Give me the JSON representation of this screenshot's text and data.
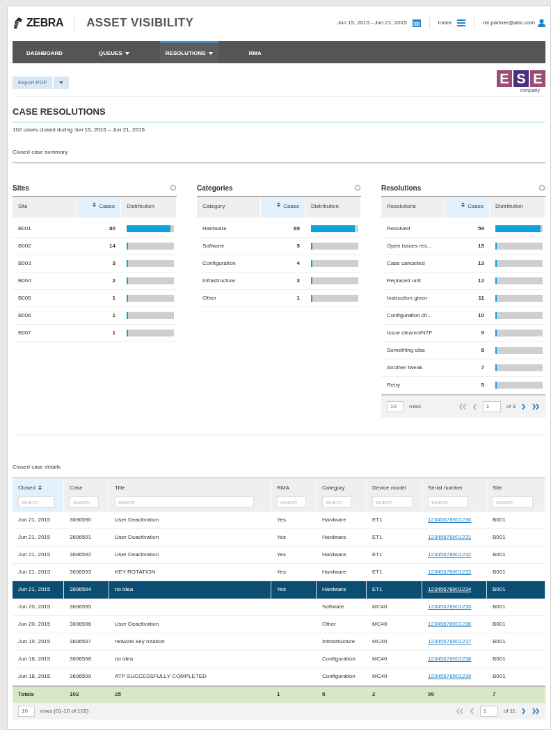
{
  "header": {
    "brand": "ZEBRA",
    "app_title": "ASSET VISIBILITY",
    "date_range": "Jun 15, 2015 - Jun 21, 2015",
    "index_label": "Index",
    "user": "mr.partner@abc.com"
  },
  "nav": [
    {
      "label": "DASHBOARD",
      "dropdown": false,
      "selected": false
    },
    {
      "label": "QUEUES",
      "dropdown": true,
      "selected": false
    },
    {
      "label": "RESOLUTIONS",
      "dropdown": true,
      "selected": true
    },
    {
      "label": "RMA",
      "dropdown": false,
      "selected": false
    }
  ],
  "export_button": "Export PDF",
  "company_logo": {
    "letters": [
      "E",
      "S",
      "E"
    ],
    "caption": "company"
  },
  "page_title": "CASE RESOLUTIONS",
  "summary_text": "102 cases closed during Jun 15, 2015 – Jun 21, 2015.",
  "summary_heading": "Closed case summary",
  "panels": [
    {
      "title": "Sites",
      "columns": [
        {
          "label": "Site",
          "sorted": false
        },
        {
          "label": "Cases",
          "sorted": true
        },
        {
          "label": "Distribution",
          "sorted": false
        }
      ],
      "rows": [
        {
          "name": "B001",
          "count": "80",
          "level": 0.92
        },
        {
          "name": "B002",
          "count": "14",
          "level": 0.03
        },
        {
          "name": "B003",
          "count": "3",
          "level": 0.03
        },
        {
          "name": "B004",
          "count": "2",
          "level": 0.03
        },
        {
          "name": "B005",
          "count": "1",
          "level": 0.03
        },
        {
          "name": "B006",
          "count": "1",
          "level": 0.03
        },
        {
          "name": "B007",
          "count": "1",
          "level": 0.03
        }
      ]
    },
    {
      "title": "Categories",
      "columns": [
        {
          "label": "Category",
          "sorted": false
        },
        {
          "label": "Cases",
          "sorted": true
        },
        {
          "label": "Distribution",
          "sorted": false
        }
      ],
      "rows": [
        {
          "name": "Hardware",
          "count": "89",
          "level": 0.92
        },
        {
          "name": "Software",
          "count": "5",
          "level": 0.03
        },
        {
          "name": "Configuration",
          "count": "4",
          "level": 0.03
        },
        {
          "name": "Infrastructure",
          "count": "3",
          "level": 0.03
        },
        {
          "name": "Other",
          "count": "1",
          "level": 0.03
        }
      ]
    },
    {
      "title": "Resolutions",
      "columns": [
        {
          "label": "Resolutions",
          "sorted": false
        },
        {
          "label": "Cases",
          "sorted": true
        },
        {
          "label": "Distribution",
          "sorted": false
        }
      ],
      "rows": [
        {
          "name": "Resolved",
          "count": "59",
          "level": 0.95
        },
        {
          "name": "Open issues res...",
          "count": "15",
          "level": 0.03
        },
        {
          "name": "Case cancelled",
          "count": "13",
          "level": 0.03
        },
        {
          "name": "Replaced unit",
          "count": "12",
          "level": 0.03
        },
        {
          "name": "Instruction given",
          "count": "11",
          "level": 0.03
        },
        {
          "name": "Configuration ch...",
          "count": "10",
          "level": 0.03
        },
        {
          "name": "Issue cleared/NTF",
          "count": "9",
          "level": 0.03
        },
        {
          "name": "Something else",
          "count": "8",
          "level": 0.03
        },
        {
          "name": "Another tweak",
          "count": "7",
          "level": 0.03
        },
        {
          "name": "Retry",
          "count": "5",
          "level": 0.03
        }
      ],
      "pager": {
        "page_size": "10",
        "rows_label": "rows",
        "page": "1",
        "of_pages": "of 3"
      }
    }
  ],
  "details": {
    "heading": "Closed case details",
    "columns": [
      {
        "label": "Closed",
        "sorted": true,
        "placeholder": "search"
      },
      {
        "label": "Case",
        "sorted": false,
        "placeholder": "search"
      },
      {
        "label": "Title",
        "sorted": false,
        "placeholder": "search"
      },
      {
        "label": "RMA",
        "sorted": false,
        "placeholder": "search"
      },
      {
        "label": "Category",
        "sorted": false,
        "placeholder": "search"
      },
      {
        "label": "Device model",
        "sorted": false,
        "placeholder": "search"
      },
      {
        "label": "Serial number",
        "sorted": false,
        "placeholder": "search"
      },
      {
        "label": "Site",
        "sorted": false,
        "placeholder": "search"
      }
    ],
    "rows": [
      {
        "selected": false,
        "cells": [
          "Jun 21, 2015",
          "3696590",
          "User Deactivation",
          "Yes",
          "Hardware",
          "ET1",
          "12345678901230",
          "B001"
        ]
      },
      {
        "selected": false,
        "cells": [
          "Jun 21, 2015",
          "3696591",
          "User Deactivation",
          "Yes",
          "Hardware",
          "ET1",
          "12345678901231",
          "B001"
        ]
      },
      {
        "selected": false,
        "cells": [
          "Jun 21, 2015",
          "3696592",
          "User Deactivation",
          "Yes",
          "Hardware",
          "ET1",
          "12345678901232",
          "B001"
        ]
      },
      {
        "selected": false,
        "cells": [
          "Jun 21, 2015",
          "3696593",
          "KEY ROTATION",
          "Yes",
          "Hardware",
          "ET1",
          "12345678901233",
          "B001"
        ]
      },
      {
        "selected": true,
        "cells": [
          "Jun 21, 2015",
          "3696594",
          "no idea",
          "Yes",
          "Hardware",
          "ET1",
          "12345678901234",
          "B001"
        ]
      },
      {
        "selected": false,
        "cells": [
          "Jun 20, 2015",
          "3696595",
          "",
          "",
          "Software",
          "MC40",
          "12345678901235",
          "B001"
        ]
      },
      {
        "selected": false,
        "cells": [
          "Jun 20, 2015",
          "3696596",
          "User Deactivation",
          "",
          "Other",
          "MC40",
          "12345678901236",
          "B001"
        ]
      },
      {
        "selected": false,
        "cells": [
          "Jun 19, 2015",
          "3696597",
          "network key rotation",
          "",
          "Infrastructure",
          "MC40",
          "12345678901237",
          "B001"
        ]
      },
      {
        "selected": false,
        "cells": [
          "Jun 18, 2015",
          "3696598",
          "no idea",
          "",
          "Configuration",
          "MC40",
          "12345678901238",
          "B001"
        ]
      },
      {
        "selected": false,
        "cells": [
          "Jun 18, 2015",
          "3696599",
          "ATP SUCCESSFULLY COMPLETED",
          "",
          "Configuration",
          "MC40",
          "12345678901239",
          "B001"
        ]
      }
    ],
    "totals": [
      "Totals",
      "102",
      "25",
      "1",
      "5",
      "2",
      "99",
      "7"
    ],
    "pager": {
      "page_size": "10",
      "rows_label": "rows (01-10 of 102)",
      "page": "1",
      "of_pages": "of 11"
    }
  }
}
